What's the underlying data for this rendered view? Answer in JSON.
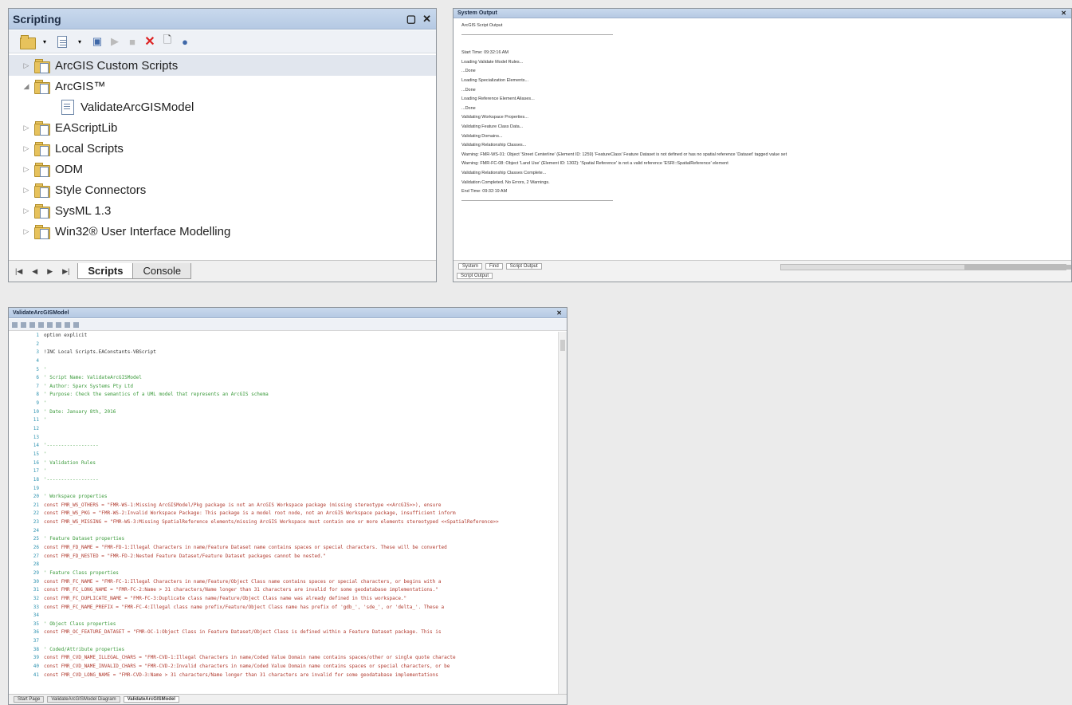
{
  "scripting": {
    "title": "Scripting",
    "tree": [
      {
        "label": "ArcGIS Custom Scripts",
        "arrow": "▷",
        "indent": 0,
        "icon": "folder",
        "selected": true
      },
      {
        "label": "ArcGIS™",
        "arrow": "◢",
        "indent": 0,
        "icon": "folder",
        "selected": false
      },
      {
        "label": "ValidateArcGISModel",
        "arrow": "",
        "indent": 1,
        "icon": "script",
        "selected": false
      },
      {
        "label": "EAScriptLib",
        "arrow": "▷",
        "indent": 0,
        "icon": "folder",
        "selected": false
      },
      {
        "label": "Local Scripts",
        "arrow": "▷",
        "indent": 0,
        "icon": "folder",
        "selected": false
      },
      {
        "label": "ODM",
        "arrow": "▷",
        "indent": 0,
        "icon": "folder",
        "selected": false
      },
      {
        "label": "Style Connectors",
        "arrow": "▷",
        "indent": 0,
        "icon": "folder",
        "selected": false
      },
      {
        "label": "SysML 1.3",
        "arrow": "▷",
        "indent": 0,
        "icon": "folder",
        "selected": false
      },
      {
        "label": "Win32® User Interface Modelling",
        "arrow": "▷",
        "indent": 0,
        "icon": "folder",
        "selected": false
      }
    ],
    "tabs": {
      "scripts": "Scripts",
      "console": "Console"
    }
  },
  "output": {
    "title": "System Output",
    "lines": [
      "ArcGIS Script Output",
      "",
      "Start Time: 09:32:16 AM",
      "Loading Validate Model Rules...",
      "...Done",
      "Loading Specialization Elements...",
      "...Done",
      "Loading Reference Element Aliases...",
      "...Done",
      "Validating Workspace Properties...",
      "Validating Feature Class Data...",
      "Validating Domains...",
      "Validating Relationship Classes...",
      "Warning: FMR-WS-01: Object 'Street Centerline' (Element ID: 1259) 'FeatureClass' Feature Dataset is not defined or has no spatial reference 'Dataset' tagged value set",
      "Warning: FMR-FC-08: Object 'Land Use' (Element ID: 1302): 'Spatial Reference' is not a valid reference 'ESRI::SpatialReference' element",
      "Validating Relationship Classes Complete...",
      "Validation Completed. No Errors, 2 Warnings.",
      "End Time: 09:32:19 AM"
    ],
    "tabs": [
      "System",
      "Find",
      "Script Output"
    ],
    "lower_tab": "Script Output"
  },
  "editor": {
    "title": "ValidateArcGISModel",
    "lines": [
      {
        "n": "1",
        "t": "option explicit",
        "c": "kw"
      },
      {
        "n": "2",
        "t": "",
        "c": ""
      },
      {
        "n": "3",
        "t": "!INC Local Scripts.EAConstants-VBScript",
        "c": "kw"
      },
      {
        "n": "4",
        "t": "",
        "c": ""
      },
      {
        "n": "5",
        "t": "'",
        "c": "comment"
      },
      {
        "n": "6",
        "t": "' Script Name: ValidateArcGISModel",
        "c": "comment"
      },
      {
        "n": "7",
        "t": "' Author:      Sparx Systems Pty Ltd",
        "c": "comment"
      },
      {
        "n": "8",
        "t": "' Purpose:     Check the semantics of a UML model that represents an ArcGIS schema",
        "c": "comment"
      },
      {
        "n": "9",
        "t": "'",
        "c": "comment"
      },
      {
        "n": "10",
        "t": "' Date:        January 8th, 2016",
        "c": "comment"
      },
      {
        "n": "11",
        "t": "'",
        "c": "comment"
      },
      {
        "n": "12",
        "t": "",
        "c": ""
      },
      {
        "n": "13",
        "t": "",
        "c": ""
      },
      {
        "n": "14",
        "t": "'------------------",
        "c": "comment"
      },
      {
        "n": "15",
        "t": "'",
        "c": "comment"
      },
      {
        "n": "16",
        "t": "' Validation Rules",
        "c": "comment"
      },
      {
        "n": "17",
        "t": "'",
        "c": "comment"
      },
      {
        "n": "18",
        "t": "'------------------",
        "c": "comment"
      },
      {
        "n": "19",
        "t": "",
        "c": ""
      },
      {
        "n": "20",
        "t": "' Workspace properties",
        "c": "comment"
      },
      {
        "n": "21",
        "t": "const FMR_WS_OTHERS = \"FMR-WS-1:Missing ArcGISModel/Pkg package is not an ArcGIS Workspace package (missing stereotype <<ArcGIS>>), ensure",
        "c": "red"
      },
      {
        "n": "22",
        "t": "const FMR_WS_PKG = \"FMR-WS-2:Invalid Workspace Package: This package is a model root node, not an ArcGIS Workspace package, insufficient inform",
        "c": "red"
      },
      {
        "n": "23",
        "t": "const FMR_WS_MISSING = \"FMR-WS-3:Missing SpatialReference elements/missing ArcGIS Workspace must contain one or more elements stereotyped <<SpatialReference>>",
        "c": "red"
      },
      {
        "n": "24",
        "t": "",
        "c": ""
      },
      {
        "n": "25",
        "t": "' Feature Dataset properties",
        "c": "comment"
      },
      {
        "n": "26",
        "t": "const FMR_FD_NAME = \"FMR-FD-1:Illegal Characters in name/Feature Dataset name contains spaces or special characters. These will be converted",
        "c": "red"
      },
      {
        "n": "27",
        "t": "const FMR_FD_NESTED = \"FMR-FD-2:Nested Feature Dataset/Feature Dataset packages cannot be nested.\"",
        "c": "red"
      },
      {
        "n": "28",
        "t": "",
        "c": ""
      },
      {
        "n": "29",
        "t": "' Feature Class properties",
        "c": "comment"
      },
      {
        "n": "30",
        "t": "const FMR_FC_NAME = \"FMR-FC-1:Illegal Characters in name/Feature/Object Class name contains spaces or special characters, or begins with a",
        "c": "red"
      },
      {
        "n": "31",
        "t": "const FMR_FC_LONG_NAME = \"FMR-FC-2:Name > 31 characters/Name longer than 31 characters are invalid for some geodatabase implementations.\"",
        "c": "red"
      },
      {
        "n": "32",
        "t": "const FMR_FC_DUPLICATE_NAME = \"FMR-FC-3:Duplicate class name/Feature/Object Class name was already defined in this workspace.\"",
        "c": "red"
      },
      {
        "n": "33",
        "t": "const FMR_FC_NAME_PREFIX = \"FMR-FC-4:Illegal class name prefix/Feature/Object Class name has prefix of 'gdb_', 'sde_', or 'delta_'. These a",
        "c": "red"
      },
      {
        "n": "34",
        "t": "",
        "c": ""
      },
      {
        "n": "35",
        "t": "' Object Class properties",
        "c": "comment"
      },
      {
        "n": "36",
        "t": "const FMR_OC_FEATURE_DATASET = \"FMR-OC-1:Object Class in Feature Dataset/Object Class is defined within a Feature Dataset package. This is",
        "c": "red"
      },
      {
        "n": "37",
        "t": "",
        "c": ""
      },
      {
        "n": "38",
        "t": "' Coded/Attribute properties",
        "c": "comment"
      },
      {
        "n": "39",
        "t": "const FMR_CVD_NAME_ILLEGAL_CHARS = \"FMR-CVD-1:Illegal Characters in name/Coded Value Domain name contains spaces/other or single quote characte",
        "c": "red"
      },
      {
        "n": "40",
        "t": "const FMR_CVD_NAME_INVALID_CHARS = \"FMR-CVD-2:Invalid characters in name/Coded Value Domain name contains spaces or special characters, or be",
        "c": "red"
      },
      {
        "n": "41",
        "t": "const FMR_CVD_LONG_NAME = \"FMR-CVD-3:Name > 31 characters/Name longer than 31 characters are invalid for some geodatabase implementations",
        "c": "red"
      }
    ],
    "tabs": [
      "Start Page",
      "ValidateArcGISModel Diagram",
      "ValidateArcGISModel"
    ]
  }
}
